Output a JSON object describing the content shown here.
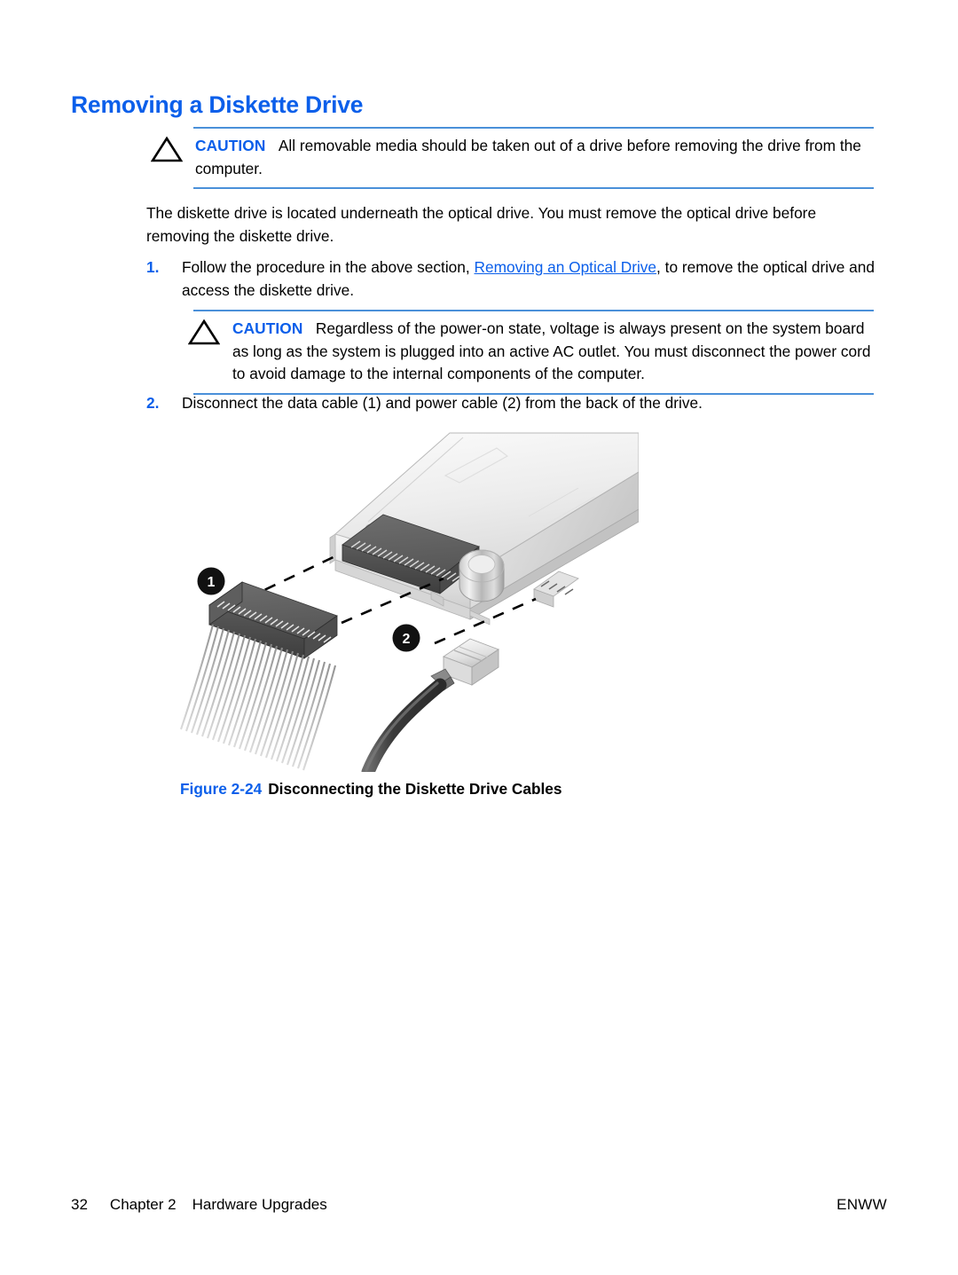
{
  "document": {
    "heading": "Removing a Diskette Drive"
  },
  "caution_1": {
    "label": "CAUTION",
    "text": "All removable media should be taken out of a drive before removing the drive from the computer.",
    "icon": "caution-triangle-icon"
  },
  "intro_paragraph": "The diskette drive is located underneath the optical drive. You must remove the optical drive before removing the diskette drive.",
  "steps": [
    {
      "marker": "1.",
      "text_before_link": "Follow the procedure in the above section, ",
      "link_text": "Removing an Optical Drive",
      "text_after_link": ", to remove the optical drive and access the diskette drive."
    },
    {
      "marker": "2.",
      "text": "Disconnect the data cable (1) and power cable (2) from the back of the drive."
    }
  ],
  "caution_2": {
    "label": "CAUTION",
    "text": "Regardless of the power-on state, voltage is always present on the system board as long as the system is plugged into an active AC outlet. You must disconnect the power cord to avoid damage to the internal components of the computer.",
    "icon": "caution-triangle-icon"
  },
  "figure": {
    "number": "Figure 2-24",
    "title": "Disconnecting the Diskette Drive Cables",
    "callouts": [
      {
        "id": "1",
        "label": "1",
        "refers_to": "data-cable-connector"
      },
      {
        "id": "2",
        "label": "2",
        "refers_to": "power-cable-connector"
      }
    ]
  },
  "footer": {
    "page_number": "32",
    "chapter": "Chapter 2",
    "chapter_title": "Hardware Upgrades",
    "locale": "ENWW"
  },
  "colors": {
    "heading_blue": "#0B5FEA",
    "rule_blue": "#4A90D9",
    "link_blue": "#0B5FEA",
    "text_black": "#000000"
  }
}
